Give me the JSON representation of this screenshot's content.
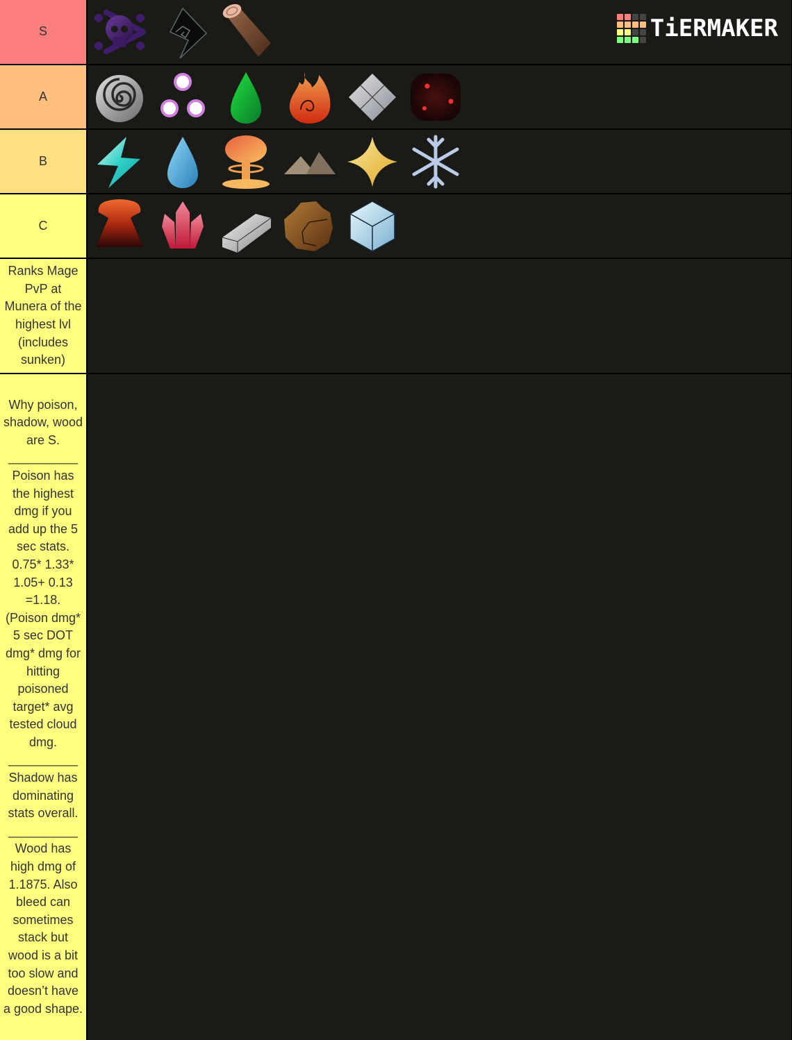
{
  "branding": {
    "logo_text": "TiERMAKER",
    "logo_grid_colors": [
      "#ff7f7f",
      "#ff7f7f",
      "#444444",
      "#444444",
      "#ffbf7f",
      "#ffbf7f",
      "#ffbf7f",
      "#ffbf7f",
      "#ffff7f",
      "#ffff7f",
      "#444444",
      "#444444",
      "#7fff7f",
      "#7fff7f",
      "#7fff7f",
      "#444444"
    ]
  },
  "tiers": [
    {
      "label": "S",
      "color": "#ff7f7f",
      "items": [
        {
          "name": "poison",
          "icon": "skull-crossbones-icon"
        },
        {
          "name": "shadow",
          "icon": "shadow-spiral-icon"
        },
        {
          "name": "wood",
          "icon": "log-icon"
        }
      ]
    },
    {
      "label": "A",
      "color": "#ffbf7f",
      "items": [
        {
          "name": "wind",
          "icon": "swirl-icon"
        },
        {
          "name": "light orbs",
          "icon": "three-orbs-icon"
        },
        {
          "name": "acid",
          "icon": "green-drop-icon"
        },
        {
          "name": "fire",
          "icon": "flame-icon"
        },
        {
          "name": "glass",
          "icon": "diamond-tiles-icon"
        },
        {
          "name": "blood",
          "icon": "dark-red-dots-icon"
        }
      ]
    },
    {
      "label": "B",
      "color": "#ffdf80",
      "items": [
        {
          "name": "lightning",
          "icon": "lightning-bolt-icon"
        },
        {
          "name": "water",
          "icon": "water-drop-icon"
        },
        {
          "name": "explosion",
          "icon": "mushroom-cloud-icon"
        },
        {
          "name": "sand",
          "icon": "dunes-icon"
        },
        {
          "name": "light",
          "icon": "four-point-star-icon"
        },
        {
          "name": "snow",
          "icon": "snowflake-icon"
        }
      ]
    },
    {
      "label": "C",
      "color": "#ffff7f",
      "items": [
        {
          "name": "magma",
          "icon": "volcano-icon"
        },
        {
          "name": "crystal",
          "icon": "crystal-icon"
        },
        {
          "name": "metal",
          "icon": "metal-ingot-icon"
        },
        {
          "name": "earth",
          "icon": "boulder-icon"
        },
        {
          "name": "ice",
          "icon": "ice-cube-icon"
        }
      ]
    },
    {
      "label": "Ranks Mage PvP at Munera of the highest lvl (includes sunken)",
      "color": "#ffff7f",
      "items": []
    },
    {
      "label": "Why poison, shadow, wood are S.\n__________\nPoison has the highest dmg if you add up the 5 sec stats. 0.75* 1.33* 1.05+ 0.13 =1.18. (Poison dmg* 5 sec DOT dmg* dmg for hitting poisoned target* avg tested cloud dmg.\n__________\nShadow has dominating stats overall.\n__________\nWood has high dmg of 1.1875. Also bleed can sometimes stack but wood is a bit too slow and doesn’t have a good shape.",
      "color": "#ffff7f",
      "items": []
    }
  ]
}
